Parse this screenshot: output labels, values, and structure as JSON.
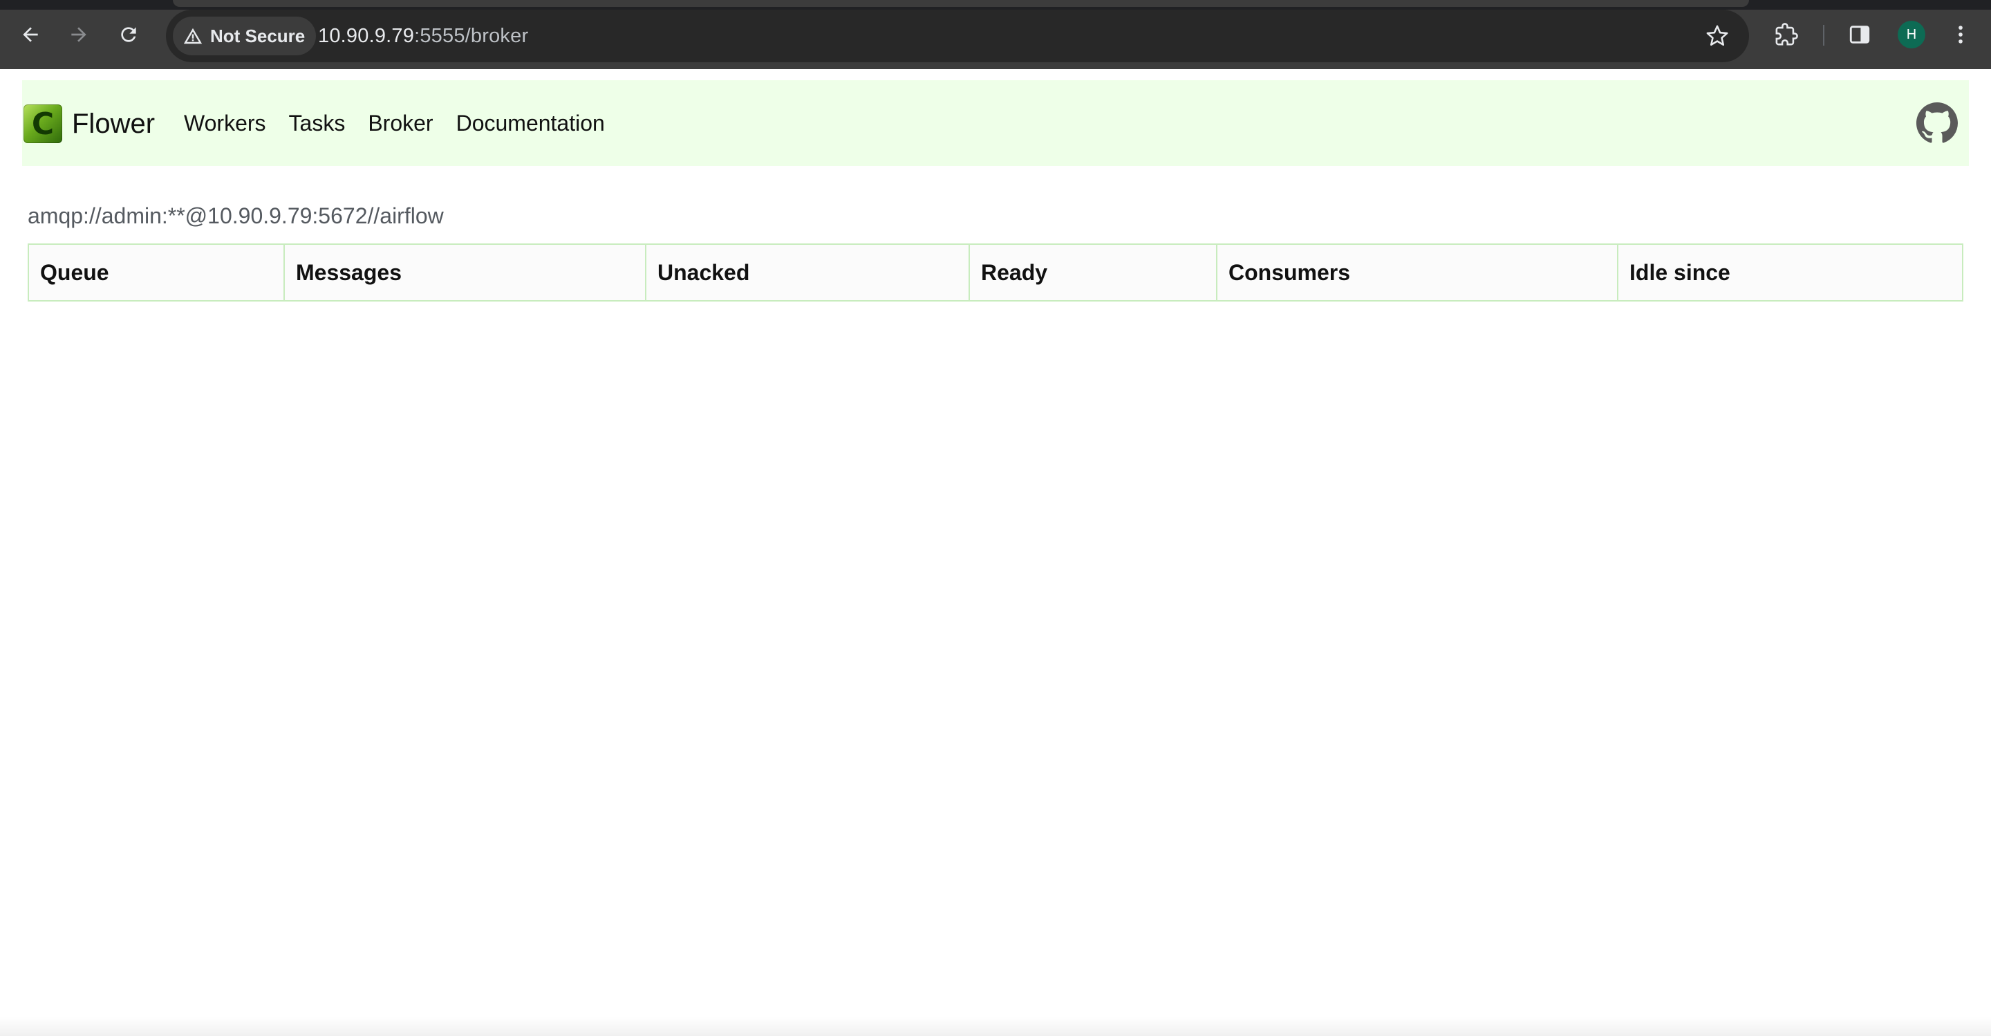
{
  "browser": {
    "security_label": "Not Secure",
    "url_host": "10.90.9.79",
    "url_path": ":5555/broker",
    "profile_initial": "H",
    "icons": [
      "back-icon",
      "forward-icon",
      "reload-icon",
      "warning-icon",
      "star-icon",
      "extensions-icon",
      "side-panel-icon",
      "more-icon"
    ]
  },
  "navbar": {
    "brand": "Flower",
    "logo_letter": "C",
    "links": [
      {
        "label": "Workers"
      },
      {
        "label": "Tasks"
      },
      {
        "label": "Broker"
      },
      {
        "label": "Documentation"
      }
    ],
    "github_icon": "github-icon"
  },
  "broker": {
    "url": "amqp://admin:**@10.90.9.79:5672//airflow",
    "table": {
      "columns": [
        "Queue",
        "Messages",
        "Unacked",
        "Ready",
        "Consumers",
        "Idle since"
      ],
      "rows": []
    }
  },
  "colors": {
    "navbar_bg": "#eeffe8",
    "table_border": "#c8ecbe",
    "chrome_bg": "#3c3c3c",
    "omnibox_bg": "#282828"
  }
}
